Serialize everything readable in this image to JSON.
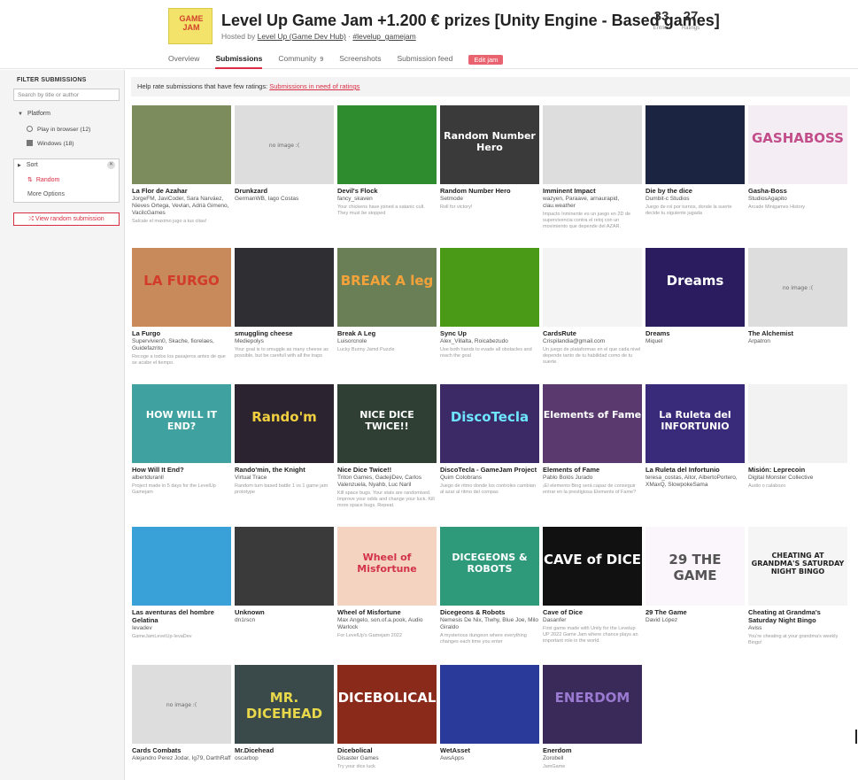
{
  "header": {
    "logo_text": "GAME JAM",
    "title": "Level Up Game Jam +1.200 € prizes [Unity Engine - Based games]",
    "hosted_prefix": "Hosted by",
    "host": "Level Up (Game Dev Hub)",
    "sep": " · ",
    "hashtag": "#levelup_gamejam",
    "entries_count": "33",
    "entries_label": "Entries",
    "ratings_count": "27",
    "ratings_label": "Ratings",
    "tabs": [
      {
        "label": "Overview"
      },
      {
        "label": "Submissions"
      },
      {
        "label": "Community",
        "count": "9"
      },
      {
        "label": "Screenshots"
      },
      {
        "label": "Submission feed"
      }
    ],
    "edit_label": "Edit jam"
  },
  "sidebar": {
    "filter_title": "FILTER SUBMISSIONS",
    "search_placeholder": "Search by title or author",
    "platform_label": "Platform",
    "platforms": [
      {
        "label": "Play in browser (12)",
        "icon": "globe-icon"
      },
      {
        "label": "Windows (18)",
        "icon": "windows-icon"
      }
    ],
    "sort_label": "Sort",
    "sort_value": "Random",
    "more_options": "More Options",
    "random_button": "View random submission"
  },
  "notice": {
    "text": "Help rate submissions that have few ratings:",
    "link": "Submissions in need of ratings"
  },
  "colors": {
    "accent": "#da2c43",
    "sidebar_bg": "#f4f4f4"
  },
  "games": [
    {
      "title": "La Flor de Azahar",
      "author": "JorgeFM, JaviCoder, Sara Narváez, Nieves Ortega, Vevlan, Adrià Gimeno, VacilcGames",
      "desc": "Salcale el maximo jugo a tus citas!",
      "thumb_text": "",
      "bg": "#7d8c5c",
      "fg": "#fff"
    },
    {
      "title": "Drunkzard",
      "author": "GermanWB, Iago Costas",
      "desc": "",
      "thumb_text": "no image :(",
      "bg": "noimg",
      "fg": "#666"
    },
    {
      "title": "Devil's Flock",
      "author": "fancy_skaven",
      "desc": "Your chickens have joined a satanic cult. They must be stopped",
      "thumb_text": "",
      "bg": "#2e8b2e",
      "fg": "#fff"
    },
    {
      "title": "Random Number Hero",
      "author": "Setmode",
      "desc": "Roll for victory!",
      "thumb_text": "Random Number Hero",
      "bg": "#3a3a3a",
      "fg": "#fff"
    },
    {
      "title": "Imminent Impact",
      "author": "wazyen, Paraave, arnaurapid, clau.weather",
      "desc": "Impacto Inminente es un juego en 2D de supervivencia contra el reloj con un movimiento que depende del AZAR.",
      "thumb_text": "",
      "bg": "noimg",
      "fg": "#666"
    },
    {
      "title": "Die by the dice",
      "author": "Dumbit-c Studios",
      "desc": "Juego de rol por turnos, donde la suerte decide tu siguiente jugada",
      "thumb_text": "",
      "bg": "#1b2440",
      "fg": "#f0c040"
    },
    {
      "title": "Gasha-Boss",
      "author": "StudiosAgapito",
      "desc": "Arcade Minigames History",
      "thumb_text": "GASHABOSS",
      "bg": "#f4eef4",
      "fg": "#c24d8a"
    },
    {
      "title": "La Furgo",
      "author": "Supervivien0, Skache, fiorelaes, Guidefazrito",
      "desc": "Recoge a todos los pasajeros antes de que se acabe el tiempo.",
      "thumb_text": "LA FURGO",
      "bg": "#c88a5a",
      "fg": "#d23a2a"
    },
    {
      "title": "smuggling cheese",
      "author": "Mediepolys",
      "desc": "Your goal is to smuggle as many cheese as possible, but be carefull with all the traps",
      "thumb_text": "",
      "bg": "#2e2e33",
      "fg": "#fff"
    },
    {
      "title": "Break A Leg",
      "author": "Luisorcnole",
      "desc": "Lucky Bunny Jamd Puzzle",
      "thumb_text": "BREAK A leg",
      "bg": "#6b7f57",
      "fg": "#f3a23a"
    },
    {
      "title": "Sync Up",
      "author": "Alex_Villalta, Roicabezudo",
      "desc": "Use both hands to evade all obstacles and reach the goal",
      "thumb_text": "",
      "bg": "#4a9a18",
      "fg": "#fff"
    },
    {
      "title": "CardsRute",
      "author": "Crispilandia@gmail.com",
      "desc": "Un juego de plataformas en el que cada nivel depende tanto de tu habilidad como de tu suerte.",
      "thumb_text": "",
      "bg": "#f4f4f4",
      "fg": "#111"
    },
    {
      "title": "Dreams",
      "author": "Miquel",
      "desc": "",
      "thumb_text": "Dreams",
      "bg": "#2a1c5e",
      "fg": "#fff"
    },
    {
      "title": "The Alchemist",
      "author": "Arpatron",
      "desc": "",
      "thumb_text": "no image :(",
      "bg": "noimg",
      "fg": "#666"
    },
    {
      "title": "How Will It End?",
      "author": "albertduranll",
      "desc": "Project made in 5 days for the LevelUp Gamejam",
      "thumb_text": "HOW WILL IT END?",
      "bg": "#3fa2a0",
      "fg": "#fff"
    },
    {
      "title": "Rando'min, the Knight",
      "author": "Virtual Trace",
      "desc": "Random turn based battle 1 vs 1 game jam prototype",
      "thumb_text": "Rando'm",
      "bg": "#2b2430",
      "fg": "#f0d040"
    },
    {
      "title": "Nice Dice Twice!!",
      "author": "Triton Games, GadejiDev, Carlos Valenzuela, Nyahb, Luc Naril",
      "desc": "Kill space bugs. Your stats are randomised. Improve your odds and change your luck. Kill more space bugs. Repeat.",
      "thumb_text": "NICE DICE TWICE!!",
      "bg": "#2f3f33",
      "fg": "#fff"
    },
    {
      "title": "DiscoTecla - GameJam Project",
      "author": "Quim Colobrans",
      "desc": "Juego de ritmo donde los controles cambian al azar al ritmo del compas",
      "thumb_text": "DiscoTecla",
      "bg": "#3b2a66",
      "fg": "#6ee6ff"
    },
    {
      "title": "Elements of Fame",
      "author": "Pablo Bolós Jurado",
      "desc": "¡El elemento Bing será capaz de conseguir entrar en la prestigiosa Elements of Fame?",
      "thumb_text": "Elements of Fame",
      "bg": "#5a3a6e",
      "fg": "#fff"
    },
    {
      "title": "La Ruleta del Infortunio",
      "author": "teresa_costas, Aitor, AlbertoPortero, XMaxQ, SlowpokeSama",
      "desc": "",
      "thumb_text": "La Ruleta del INFORTUNIO",
      "bg": "#3a2a7a",
      "fg": "#fff"
    },
    {
      "title": "Misión: Leprecoin",
      "author": "Digital Monster Collective",
      "desc": "Audio o calabozo",
      "thumb_text": "",
      "bg": "#f2f2f2",
      "fg": "#c99a20"
    },
    {
      "title": "Las aventuras del hombre Gelatina",
      "author": "Ievadev",
      "desc": "GameJamLevelUp-IevaDev",
      "thumb_text": "",
      "bg": "#3aa0d8",
      "fg": "#fff"
    },
    {
      "title": "Unknown",
      "author": "dn1rscn",
      "desc": "",
      "thumb_text": "",
      "bg": "#3a3a3a",
      "fg": "#fff"
    },
    {
      "title": "Wheel of Misfortune",
      "author": "Max Angelo, son.of.a.pook, Audio Warlock",
      "desc": "For LevelUp's Gamejam 2022",
      "thumb_text": "Wheel of Misfortune",
      "bg": "#f4d4c0",
      "fg": "#d2324a"
    },
    {
      "title": "Dicegeons & Robots",
      "author": "Nemesis De Nix, Tlwhy, Blue Joe, Milo Giraldo",
      "desc": "A mysterious dungeon where everything changes each time you enter",
      "thumb_text": "DICEGEONS & ROBOTS",
      "bg": "#2f9a7a",
      "fg": "#fff"
    },
    {
      "title": "Cave of Dice",
      "author": "Dasanfer",
      "desc": "First game made with Unity for the Levelup UP 2022 Game Jam where chance plays an important role in the world.",
      "thumb_text": "CAVE of DICE",
      "bg": "#111111",
      "fg": "#fff"
    },
    {
      "title": "29 The Game",
      "author": "David López",
      "desc": "",
      "thumb_text": "29 THE GAME",
      "bg": "#fbf6fb",
      "fg": "#555"
    },
    {
      "title": "Cheating at Grandma's Saturday Night Bingo",
      "author": "Aviss",
      "desc": "You're cheating at your grandma's weekly Bingo!",
      "thumb_text": "CHEATING AT GRANDMA'S SATURDAY NIGHT BINGO",
      "bg": "#f5f5f5",
      "fg": "#222"
    },
    {
      "title": "Cards Combats",
      "author": "Alejandro Perez Jodar, Ig79, DarthRaff",
      "desc": "",
      "thumb_text": "no image :(",
      "bg": "noimg",
      "fg": "#666"
    },
    {
      "title": "Mr.Dicehead",
      "author": "oscarbop",
      "desc": "",
      "thumb_text": "MR. DICEHEAD",
      "bg": "#3a4a4a",
      "fg": "#e8d84a"
    },
    {
      "title": "Dicebolical",
      "author": "Disaster Games",
      "desc": "Try your dice luck",
      "thumb_text": "DICEBOLICAL",
      "bg": "#8a2a1a",
      "fg": "#fff"
    },
    {
      "title": "WetAsset",
      "author": "AwsApps",
      "desc": "",
      "thumb_text": "",
      "bg": "#2a3a9a",
      "fg": "#fff"
    },
    {
      "title": "Enerdom",
      "author": "Zorobell",
      "desc": "JamGame",
      "thumb_text": "ENERDOM",
      "bg": "#3a2a5a",
      "fg": "#9a7ad0"
    }
  ]
}
